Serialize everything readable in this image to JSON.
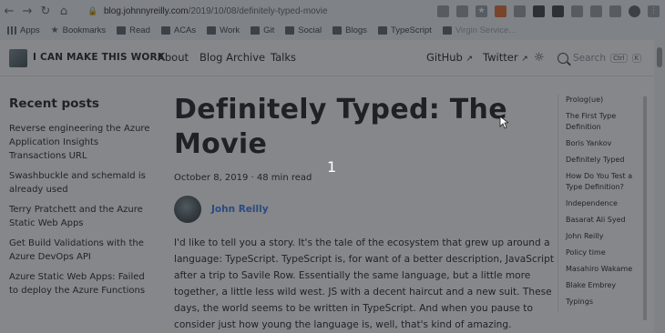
{
  "browser": {
    "url_host": "blog.johnnyreilly.com",
    "url_path": "/2019/10/08/definitely-typed-movie",
    "bookmarks": [
      {
        "label": "Apps"
      },
      {
        "label": "Bookmarks"
      },
      {
        "label": "Read"
      },
      {
        "label": "ACAs"
      },
      {
        "label": "Work"
      },
      {
        "label": "Git"
      },
      {
        "label": "Social"
      },
      {
        "label": "Blogs"
      },
      {
        "label": "TypeScript"
      },
      {
        "label": "Virgin Service..."
      }
    ]
  },
  "navbar": {
    "brand": "I CAN MAKE THIS WORK",
    "links": [
      "About",
      "Blog Archive",
      "Talks"
    ],
    "github": "GitHub",
    "twitter": "Twitter",
    "search_placeholder": "Search",
    "search_key_1": "Ctrl",
    "search_key_2": "K"
  },
  "sidebar": {
    "title": "Recent posts",
    "posts": [
      "Reverse engineering the Azure Application Insights Transactions URL",
      "Swashbuckle and schemaId is already used",
      "Terry Pratchett and the Azure Static Web Apps",
      "Get Build Validations with the Azure DevOps API",
      "Azure Static Web Apps: Failed to deploy the Azure Functions"
    ]
  },
  "article": {
    "title": "Definitely Typed: The Movie",
    "meta": "October 8, 2019 · 48 min read",
    "author": "John Reilly",
    "body": "I'd like to tell you a story. It's the tale of the ecosystem that grew up around a language: TypeScript. TypeScript is, for want of a better description, JavaScript after a trip to Savile Row. Essentially the same language, but a little more together, a little less wild west. JS with a decent haircut and a new suit. These days, the world seems to be written in TypeScript. And when you pause to consider just how young the language is, well, that's kind of amazing."
  },
  "toc": [
    "Prolog(ue)",
    "The First Type Definition",
    "Boris Yankov",
    "Definitely Typed",
    "How Do You Test a Type Definition?",
    "Independence",
    "Basarat Ali Syed",
    "John Reilly",
    "Policy time",
    "Masahiro Wakame",
    "Blake Embrey",
    "Typings"
  ],
  "overlay_marker": "1"
}
